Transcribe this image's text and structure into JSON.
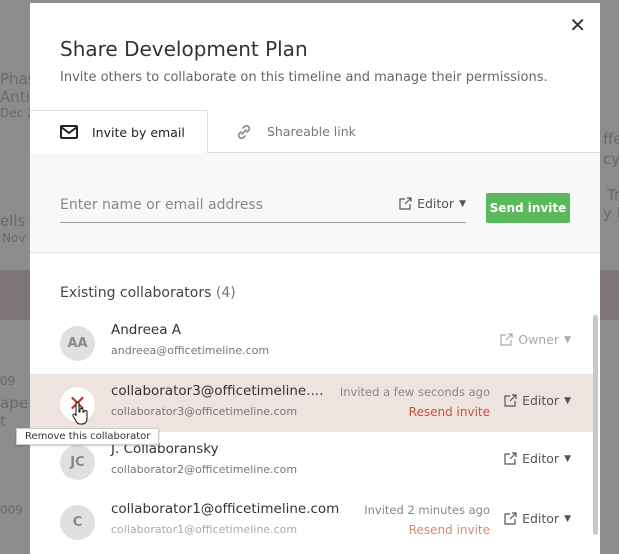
{
  "background": {
    "fragments": [
      "Phas",
      "Anti",
      "Dec 2",
      "ells",
      "Nov",
      "09",
      "ape",
      "t",
      "009",
      "ffe",
      "cy",
      "Tr",
      "y F"
    ]
  },
  "modal": {
    "title": "Share Development Plan",
    "subtitle": "Invite others to collaborate on this timeline and manage their permissions.",
    "close_icon": "close-icon"
  },
  "tabs": [
    {
      "label": "Invite by email",
      "icon": "envelope-icon",
      "active": true
    },
    {
      "label": "Shareable link",
      "icon": "link-icon",
      "active": false
    }
  ],
  "invite": {
    "placeholder": "Enter name or email address",
    "value": "",
    "role": "Editor",
    "send_label": "Send invite"
  },
  "collaborators": {
    "heading": "Existing collaborators",
    "count": "(4)",
    "items": [
      {
        "initials": "AA",
        "name": "Andreea A",
        "email": "andreea@officetimeline.com",
        "status": "",
        "resend": "",
        "role": "Owner"
      },
      {
        "initials": "",
        "name": "collaborator3@officetimeline....",
        "email": "collaborator3@officetimeline.com",
        "status": "Invited a few seconds ago",
        "resend": "Resend invite",
        "role": "Editor"
      },
      {
        "initials": "JC",
        "name": "J. Collaboransky",
        "email": "collaborator2@officetimeline.com",
        "status": "",
        "resend": "",
        "role": "Editor"
      },
      {
        "initials": "C",
        "name": "collaborator1@officetimeline.com",
        "email": "collaborator1@officetimeline.com",
        "status": "Invited 2 minutes ago",
        "resend": "Resend invite",
        "role": "Editor"
      }
    ]
  },
  "tooltip": "Remove this collaborator",
  "colors": {
    "accent": "#5cb85c",
    "highlight": "#efe3df",
    "resend": "#c4563a",
    "remove": "#c0302a"
  }
}
